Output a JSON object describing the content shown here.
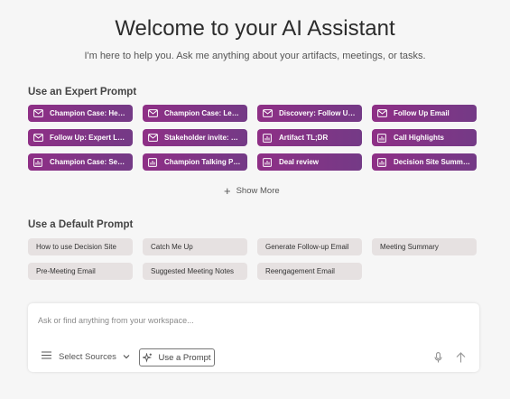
{
  "header": {
    "title": "Welcome to your AI Assistant",
    "subtitle": "I'm here to help you. Ask me anything about your artifacts, meetings, or tasks."
  },
  "expert": {
    "heading": "Use an Expert Prompt",
    "items": [
      {
        "label": "Champion Case: Heal...",
        "icon": "mail-icon"
      },
      {
        "label": "Champion Case: Legal",
        "icon": "mail-icon"
      },
      {
        "label": "Discovery: Follow Up ...",
        "icon": "mail-icon"
      },
      {
        "label": "Follow Up Email",
        "icon": "mail-icon"
      },
      {
        "label": "Follow Up: Expert Level",
        "icon": "mail-icon"
      },
      {
        "label": "Stakeholder invite: CFO",
        "icon": "mail-icon"
      },
      {
        "label": "Artifact TL;DR",
        "icon": "chart-icon"
      },
      {
        "label": "Call Highlights",
        "icon": "chart-icon"
      },
      {
        "label": "Champion Case: Secu...",
        "icon": "chart-icon"
      },
      {
        "label": "Champion Talking Poi...",
        "icon": "chart-icon"
      },
      {
        "label": "Deal review",
        "icon": "chart-icon"
      },
      {
        "label": "Decision Site Summar...",
        "icon": "chart-icon"
      }
    ],
    "show_more": "Show More"
  },
  "default": {
    "heading": "Use a Default Prompt",
    "items": [
      "How to use Decision Site",
      "Catch Me Up",
      "Generate Follow-up Email",
      "Meeting Summary",
      "Pre-Meeting Email",
      "Suggested Meeting Notes",
      "Reengagement Email"
    ]
  },
  "composer": {
    "placeholder": "Ask or find anything from your workspace...",
    "sources_label": "Select Sources",
    "use_prompt_label": "Use a Prompt"
  },
  "colors": {
    "expert_start": "#8e2f86",
    "expert_end": "#743a86",
    "default_bg": "#e6e1e1",
    "background": "#f6f6f6"
  }
}
